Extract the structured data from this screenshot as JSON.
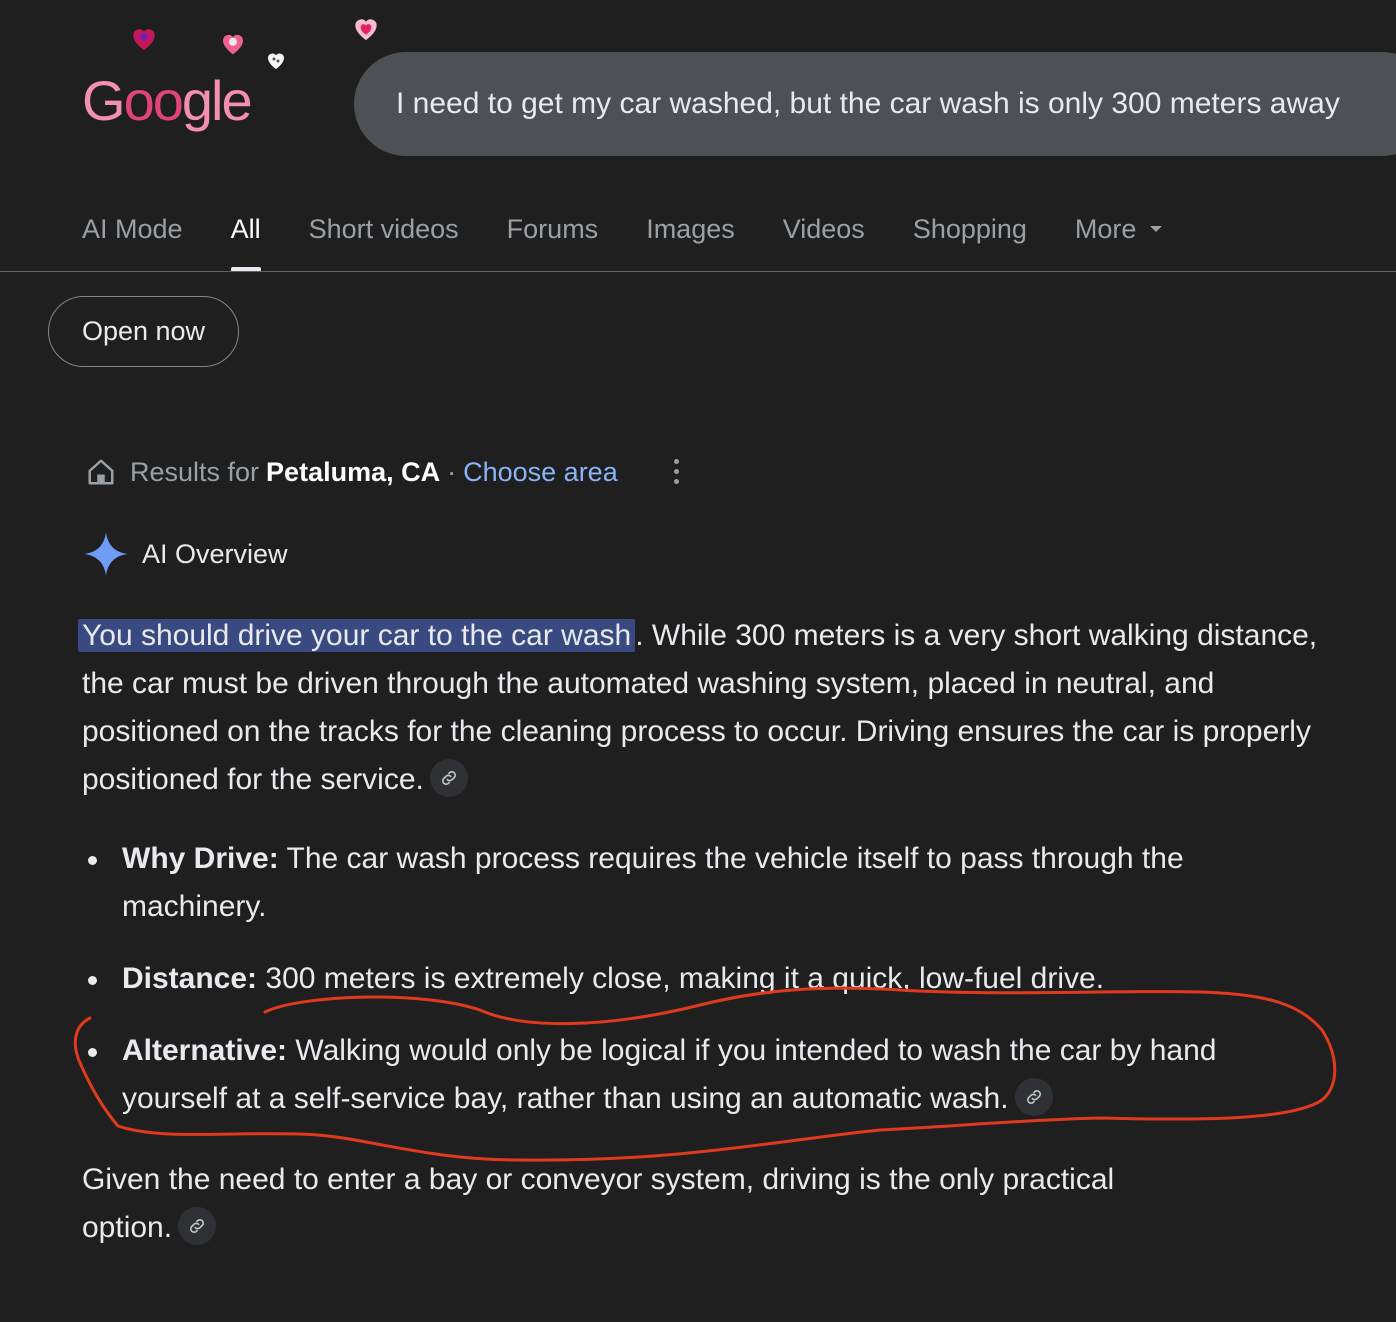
{
  "logo": {
    "text_prefix": "G",
    "text_doodle": "oo",
    "text_suffix": "gle"
  },
  "search": {
    "query": "I need to get my car washed, but the car wash is only 300 meters away"
  },
  "tabs": [
    {
      "label": "AI Mode",
      "active": false
    },
    {
      "label": "All",
      "active": true
    },
    {
      "label": "Short videos",
      "active": false
    },
    {
      "label": "Forums",
      "active": false
    },
    {
      "label": "Images",
      "active": false
    },
    {
      "label": "Videos",
      "active": false
    },
    {
      "label": "Shopping",
      "active": false
    },
    {
      "label": "More",
      "active": false
    }
  ],
  "filter_chip": {
    "label": "Open now"
  },
  "location": {
    "prefix": "Results for",
    "place": "Petaluma, CA",
    "separator": "·",
    "choose_area": "Choose area"
  },
  "ai_overview": {
    "title": "AI Overview",
    "lead_highlight": "You should drive your car to the car wash",
    "lead_rest": ". While 300 meters is a very short walking distance, the car must be driven through the automated washing system, placed in neutral, and positioned on the tracks for the cleaning process to occur. Driving ensures the car is properly positioned for the service.",
    "bullets": [
      {
        "term": "Why Drive:",
        "text": " The car wash process requires the vehicle itself to pass through the machinery."
      },
      {
        "term": "Distance:",
        "text": " 300 meters is extremely close, making it a quick, low-fuel drive."
      },
      {
        "term": "Alternative:",
        "text": " Walking would only be logical if you intended to wash the car by hand yourself at a self-service bay, rather than using an automatic wash."
      }
    ],
    "conclusion": "Given the need to enter a bay or conveyor system, driving is the only practical option."
  },
  "colors": {
    "background": "#1f1f1f",
    "search_box": "#4d5156",
    "highlight": "#394a82",
    "link": "#8ab4f8",
    "annotation": "#e03a1e"
  }
}
